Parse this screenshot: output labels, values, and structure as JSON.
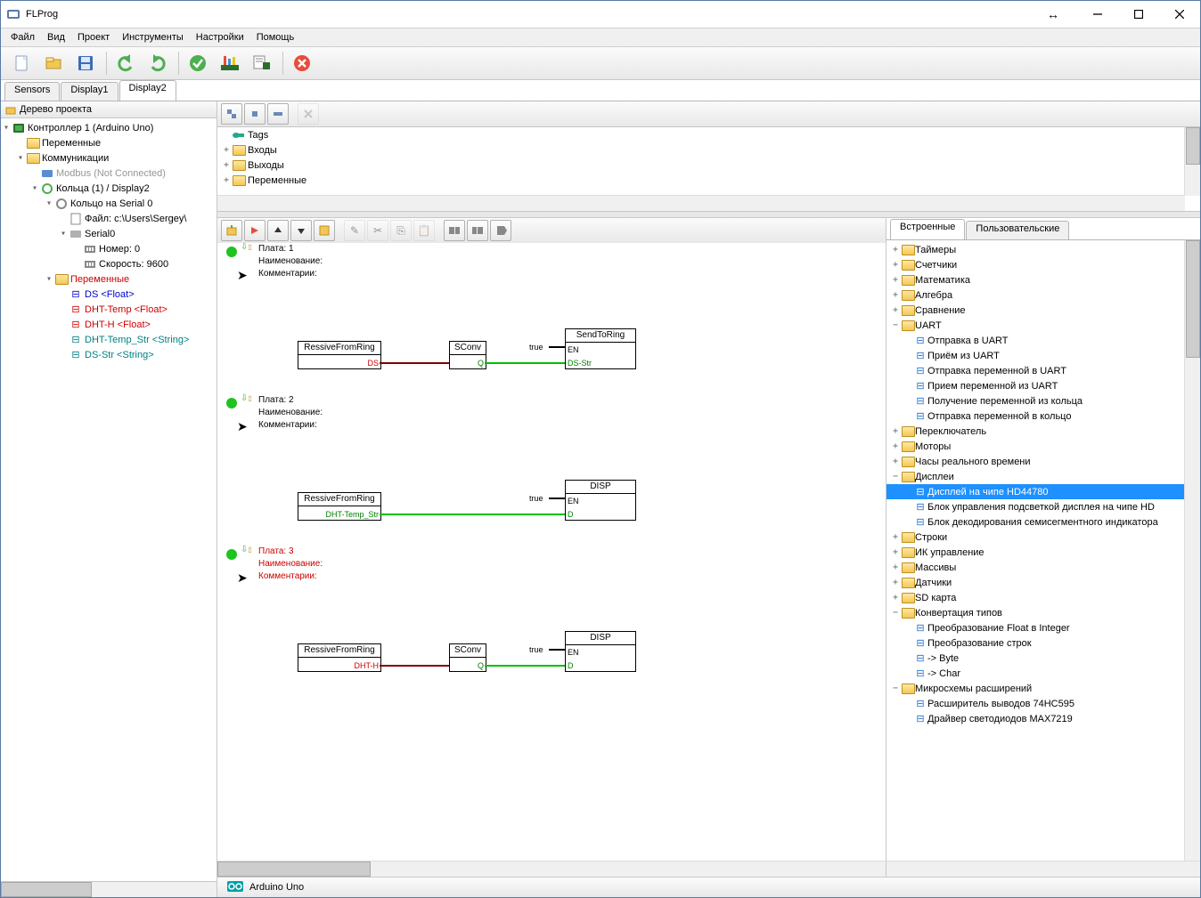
{
  "title": "FLProg",
  "menu": [
    "Файл",
    "Вид",
    "Проект",
    "Инструменты",
    "Настройки",
    "Помощь"
  ],
  "tabs": [
    "Sensors",
    "Display1",
    "Display2"
  ],
  "active_tab": 2,
  "leftpane_title": "Дерево проекта",
  "project_tree": {
    "controller": "Контроллер 1 (Arduino Uno)",
    "variables": "Переменные",
    "comms": "Коммуникации",
    "modbus": "Modbus (Not Connected)",
    "rings": "Кольца (1) / Display2",
    "ring0": "Кольцо  на Serial 0",
    "file": "Файл: c:\\Users\\Sergey\\",
    "serial0": "Serial0",
    "number": "Номер: 0",
    "speed": "Скорость: 9600",
    "vars2": "Переменные",
    "v_ds": "DS <Float>",
    "v_dhttemp": "DHT-Temp <Float>",
    "v_dhth": "DHT-H <Float>",
    "v_dhttempstr": "DHT-Temp_Str <String>",
    "v_dsstr": "DS-Str <String>"
  },
  "tags": {
    "tags": "Tags",
    "inputs": "Входы",
    "outputs": "Выходы",
    "vars": "Переменные"
  },
  "rungs": [
    {
      "num": "Плата: 1",
      "name": "Наименование:",
      "comm": "Комментарии:",
      "color": "#000",
      "b1": "RessiveFromRing",
      "p1": "DS",
      "b2": "SConv",
      "w2": "true",
      "b3": "SendToRing",
      "p3en": "EN",
      "p3d": "DS-Str"
    },
    {
      "num": "Плата: 2",
      "name": "Наименование:",
      "comm": "Комментарии:",
      "color": "#000",
      "b1": "RessiveFromRing",
      "p1": "DHT-Temp_Str",
      "w2": "true",
      "b3": "DISP",
      "p3en": "EN",
      "p3d": "D"
    },
    {
      "num": "Плата: 3",
      "name": "Наименование:",
      "comm": "Комментарии:",
      "color": "#c00",
      "b1": "RessiveFromRing",
      "p1": "DHT-H",
      "b2": "SConv",
      "w2": "true",
      "b3": "DISP",
      "p3en": "EN",
      "p3d": "D"
    }
  ],
  "right_tabs": [
    "Встроенные",
    "Пользовательские"
  ],
  "right_active": 0,
  "right_tree": [
    {
      "d": 1,
      "exp": "+",
      "t": "Таймеры"
    },
    {
      "d": 1,
      "exp": "+",
      "t": "Счетчики"
    },
    {
      "d": 1,
      "exp": "+",
      "t": "Математика"
    },
    {
      "d": 1,
      "exp": "+",
      "t": "Алгебра"
    },
    {
      "d": 1,
      "exp": "+",
      "t": "Сравнение"
    },
    {
      "d": 1,
      "exp": "−",
      "t": "UART"
    },
    {
      "d": 2,
      "t": "Отправка в UART"
    },
    {
      "d": 2,
      "t": "Приём из UART"
    },
    {
      "d": 2,
      "t": "Отправка переменной в UART"
    },
    {
      "d": 2,
      "t": "Прием переменной из UART"
    },
    {
      "d": 2,
      "t": "Получение переменной из кольца"
    },
    {
      "d": 2,
      "t": "Отправка переменной в кольцо"
    },
    {
      "d": 1,
      "exp": "+",
      "t": "Переключатель"
    },
    {
      "d": 1,
      "exp": "+",
      "t": "Моторы"
    },
    {
      "d": 1,
      "exp": "+",
      "t": "Часы реального времени"
    },
    {
      "d": 1,
      "exp": "−",
      "t": "Дисплеи"
    },
    {
      "d": 2,
      "t": "Дисплей на чипе HD44780",
      "sel": true
    },
    {
      "d": 2,
      "t": "Блок управления подсветкой дисплея на чипе HD"
    },
    {
      "d": 2,
      "t": "Блок декодирования семисегментного индикатора"
    },
    {
      "d": 1,
      "exp": "+",
      "t": "Строки"
    },
    {
      "d": 1,
      "exp": "+",
      "t": "ИК управление"
    },
    {
      "d": 1,
      "exp": "+",
      "t": "Массивы"
    },
    {
      "d": 1,
      "exp": "+",
      "t": "Датчики"
    },
    {
      "d": 1,
      "exp": "+",
      "t": "SD карта"
    },
    {
      "d": 1,
      "exp": "−",
      "t": "Конвертация типов"
    },
    {
      "d": 2,
      "t": "Преобразование Float в Integer"
    },
    {
      "d": 2,
      "t": "Преобразование строк"
    },
    {
      "d": 2,
      "t": "-> Byte"
    },
    {
      "d": 2,
      "t": "-> Char"
    },
    {
      "d": 1,
      "exp": "−",
      "t": "Микросхемы расширений"
    },
    {
      "d": 2,
      "t": "Расширитель выводов 74HC595"
    },
    {
      "d": 2,
      "t": "Драйвер светодиодов MAX7219"
    }
  ],
  "status": "Arduino Uno"
}
